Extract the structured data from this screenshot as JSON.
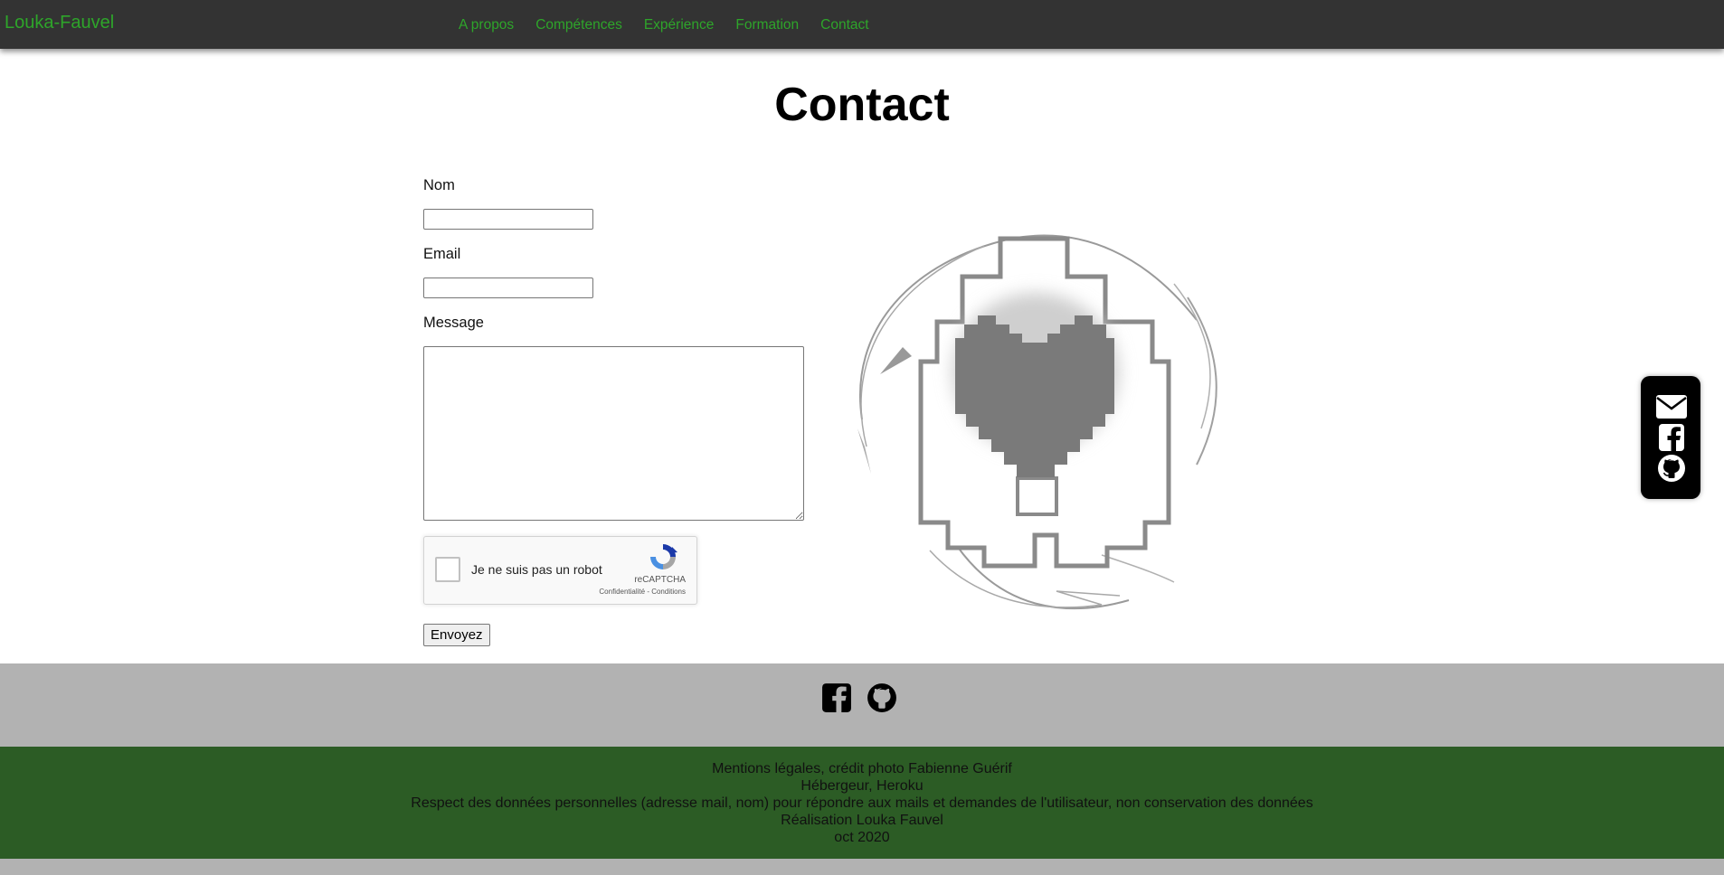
{
  "nav": {
    "brand": "Louka-Fauvel",
    "links": [
      "A propos",
      "Compétences",
      "Expérience",
      "Formation",
      "Contact"
    ]
  },
  "page": {
    "title": "Contact"
  },
  "form": {
    "name_label": "Nom",
    "name_value": "",
    "email_label": "Email",
    "email_value": "",
    "message_label": "Message",
    "message_value": "",
    "recaptcha": {
      "label": "Je ne suis pas un robot",
      "brand": "reCAPTCHA",
      "links": "Confidentialité - Conditions"
    },
    "submit_label": "Envoyez"
  },
  "floating_social": {
    "icons": [
      "envelope-icon",
      "facebook-icon",
      "github-icon"
    ]
  },
  "footer": {
    "social_icons": [
      "facebook-icon",
      "github-icon"
    ],
    "legal_lines": [
      "Mentions légales, crédit photo Fabienne Guérif",
      "Hébergeur, Heroku",
      "Respect des données personnelles (adresse mail, nom) pour répondre aux mails et demandes de l'utilisateur, non conservation des données",
      "Réalisation Louka Fauvel",
      "oct 2020"
    ]
  },
  "colors": {
    "accent_green": "#2ea52a",
    "nav_bg": "#333333",
    "footer_gray": "#b2b2b2",
    "footer_green": "#2c5c25"
  }
}
